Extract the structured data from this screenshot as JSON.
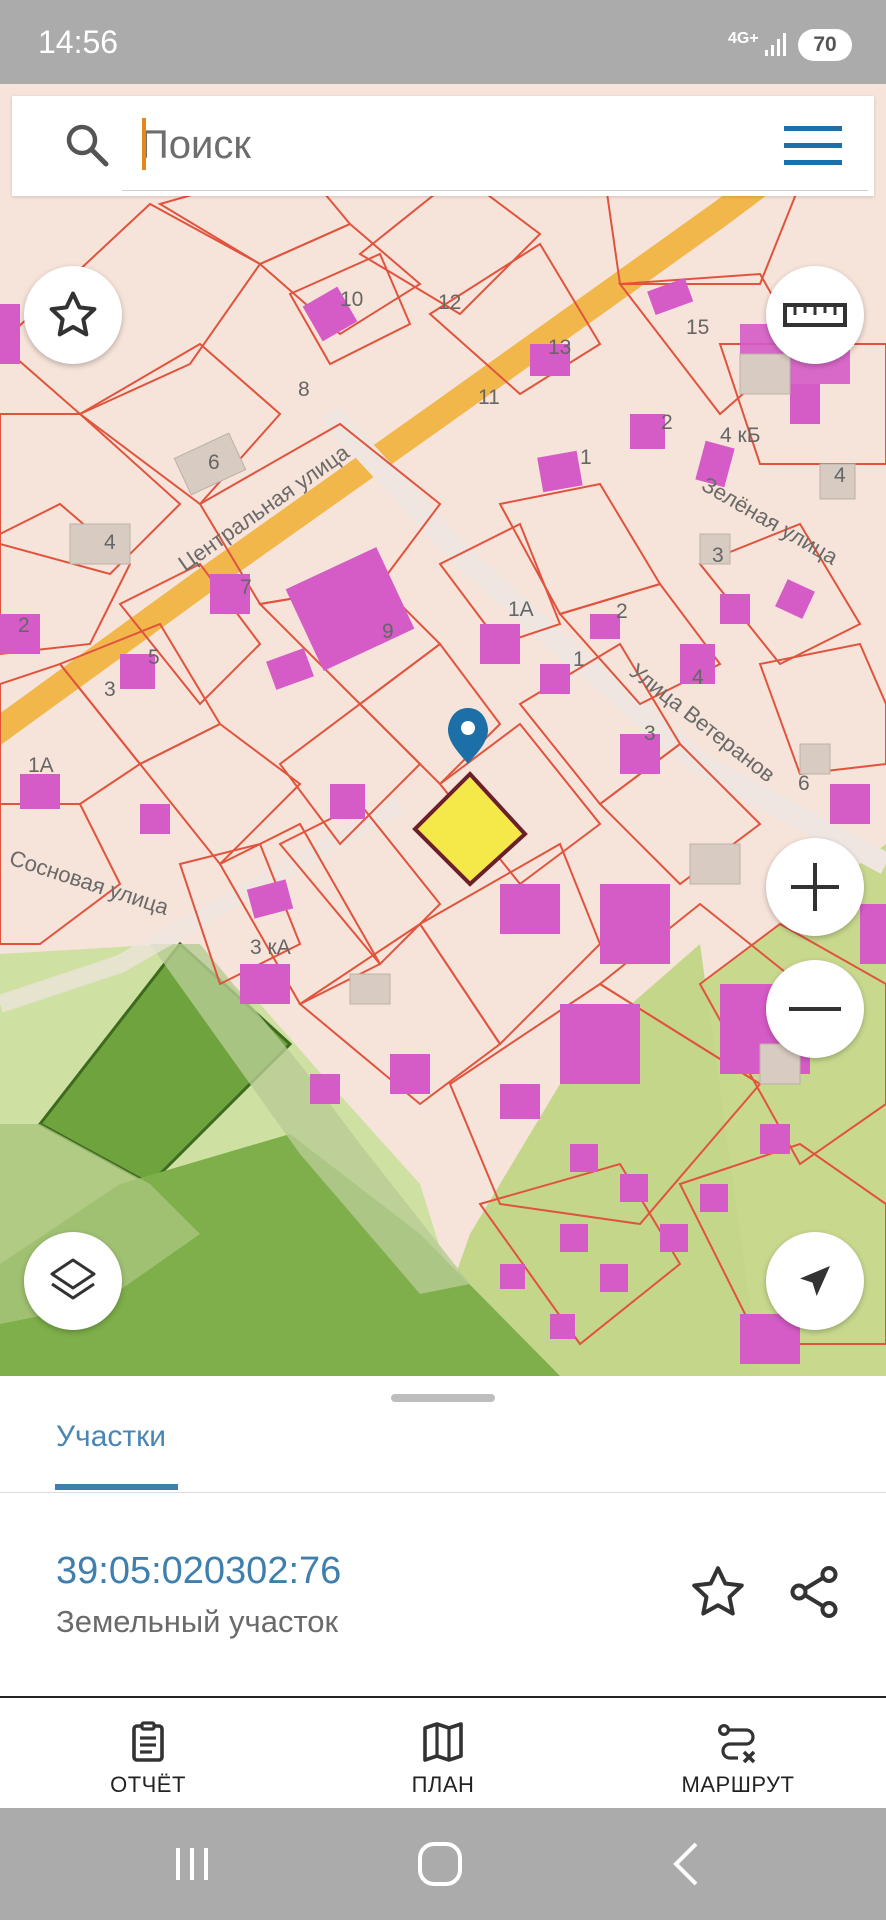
{
  "status_bar": {
    "time": "14:56",
    "network": "4G+",
    "battery": "70"
  },
  "search": {
    "placeholder": "Поиск",
    "value": ""
  },
  "map": {
    "street_labels": [
      "Центральная улица",
      "Зелёная улица",
      "Улица Ветеранов",
      "Сосновая улица"
    ],
    "house_numbers": [
      "10",
      "12",
      "13",
      "15",
      "8",
      "11",
      "6",
      "2",
      "4 кБ",
      "4",
      "1",
      "3",
      "4",
      "7",
      "9",
      "1А",
      "2",
      "1",
      "2",
      "5",
      "3",
      "4",
      "3",
      "6",
      "1А",
      "3 кА"
    ],
    "colors": {
      "background": "#f6e3d9",
      "parcel_border": "#e0543e",
      "building": "#d55bc6",
      "road": "#f2b74a",
      "green": "#8fb05a",
      "selected_parcel": "#f5e94a"
    }
  },
  "panel": {
    "tab_label": "Участки",
    "parcel_id": "39:05:020302:76",
    "parcel_type": "Земельный участок"
  },
  "bottom_nav": {
    "report": "ОТЧЁТ",
    "plan": "ПЛАН",
    "route": "МАРШРУТ"
  },
  "icons": [
    "search-icon",
    "menu-icon",
    "star-icon",
    "ruler-icon",
    "layers-icon",
    "zoom-in-icon",
    "zoom-out-icon",
    "location-arrow-icon",
    "share-icon",
    "clipboard-icon",
    "map-icon",
    "route-icon"
  ],
  "accent_color": "#3f7fad"
}
